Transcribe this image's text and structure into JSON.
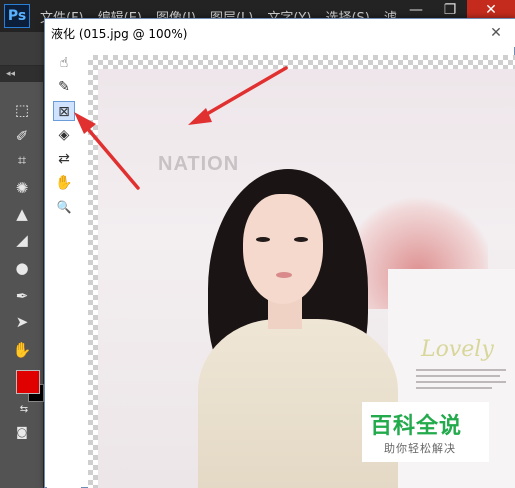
{
  "app": {
    "logo": "Ps",
    "menu": [
      "文件(F)",
      "编辑(E)",
      "图像(I)",
      "图层(L)",
      "文字(Y)",
      "选择(S)",
      "滤"
    ],
    "window_controls": [
      "—",
      "❐",
      "✕"
    ]
  },
  "liquify": {
    "title": "液化 (015.jpg @ 100%)",
    "close": "✕",
    "tools": [
      {
        "name": "forward-warp",
        "icon": "forward-warp-icon",
        "glyph": "☝"
      },
      {
        "name": "reconstruct",
        "icon": "reconstruct-icon",
        "glyph": "✎"
      },
      {
        "name": "pucker",
        "icon": "pucker-icon",
        "glyph": "⊠",
        "active": true
      },
      {
        "name": "bloat",
        "icon": "bloat-icon",
        "glyph": "◈"
      },
      {
        "name": "push-left",
        "icon": "push-left-icon",
        "glyph": "⇄"
      },
      {
        "name": "hand",
        "icon": "hand-icon",
        "glyph": "✋"
      },
      {
        "name": "zoom",
        "icon": "zoom-icon",
        "glyph": "🔍"
      }
    ]
  },
  "photo": {
    "background_text": "NATION",
    "script_text": "Lovely"
  },
  "colors": {
    "foreground": "#e00000",
    "background": "#000000",
    "accent": "#e03030"
  },
  "watermark": {
    "title": "百科全说",
    "subtitle": "助你轻松解决"
  }
}
